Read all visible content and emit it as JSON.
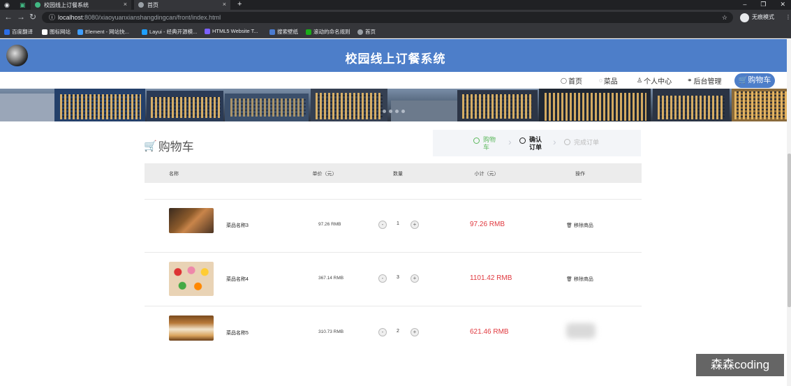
{
  "browser": {
    "tabs": [
      {
        "label": "校园线上订餐系统",
        "icon_color": "#41b883"
      },
      {
        "label": "首页",
        "icon_color": "#9aa0a6"
      }
    ],
    "new_tab": "+",
    "url_host": "localhost",
    "url_path": ":8080/xiaoyuanxianshangdingcan/front/index.html",
    "incognito": "无痕模式",
    "bookmarks": [
      {
        "label": "百度翻译",
        "color": "#2b6de5"
      },
      {
        "label": "图标网站",
        "color": "#ffffff"
      },
      {
        "label": "Element - 网站快...",
        "color": "#409eff"
      },
      {
        "label": "Layui - 经典开源模...",
        "color": "#1e9fff"
      },
      {
        "label": "HTML5 Website T...",
        "color": "#7b61ff"
      },
      {
        "label": "搜索壁纸",
        "color": "#4a7bd0"
      },
      {
        "label": "滚动的命名规则",
        "color": "#1aad19"
      },
      {
        "label": "首页",
        "color": "#9aa0a6"
      }
    ]
  },
  "site": {
    "title": "校园线上订餐系统",
    "nav": [
      {
        "label": "首页",
        "icon": "home-icon",
        "glyph": "◯"
      },
      {
        "label": "菜品",
        "icon": "dish-icon",
        "glyph": "◌"
      },
      {
        "label": "个人中心",
        "icon": "user-icon",
        "glyph": "♙"
      },
      {
        "label": "后台管理",
        "icon": "link-icon",
        "glyph": "⚭"
      }
    ],
    "cart_button": "🛒购物车"
  },
  "cart": {
    "title": "购物车",
    "steps": [
      {
        "label": "购物车",
        "color": "#5cb85c"
      },
      {
        "label": "确认订单",
        "color": "#222222"
      },
      {
        "label": "完成订单",
        "color": "#bbbbbb"
      }
    ],
    "columns": [
      "名称",
      "单价（元）",
      "数量",
      "小计（元）",
      "操作"
    ],
    "items": [
      {
        "name": "菜品名称3",
        "price": "97.26 RMB",
        "qty": "1",
        "subtotal": "97.26 RMB",
        "remove": "移除商品"
      },
      {
        "name": "菜品名称4",
        "price": "367.14 RMB",
        "qty": "3",
        "subtotal": "1101.42 RMB",
        "remove": "移除商品"
      },
      {
        "name": "菜品名称5",
        "price": "310.73 RMB",
        "qty": "2",
        "subtotal": "621.46 RMB",
        "remove": ""
      }
    ],
    "minus": "-",
    "plus": "+"
  },
  "watermark": "森森coding",
  "colors": {
    "header": "#4d7ec9",
    "subtotal": "#e0383e"
  }
}
